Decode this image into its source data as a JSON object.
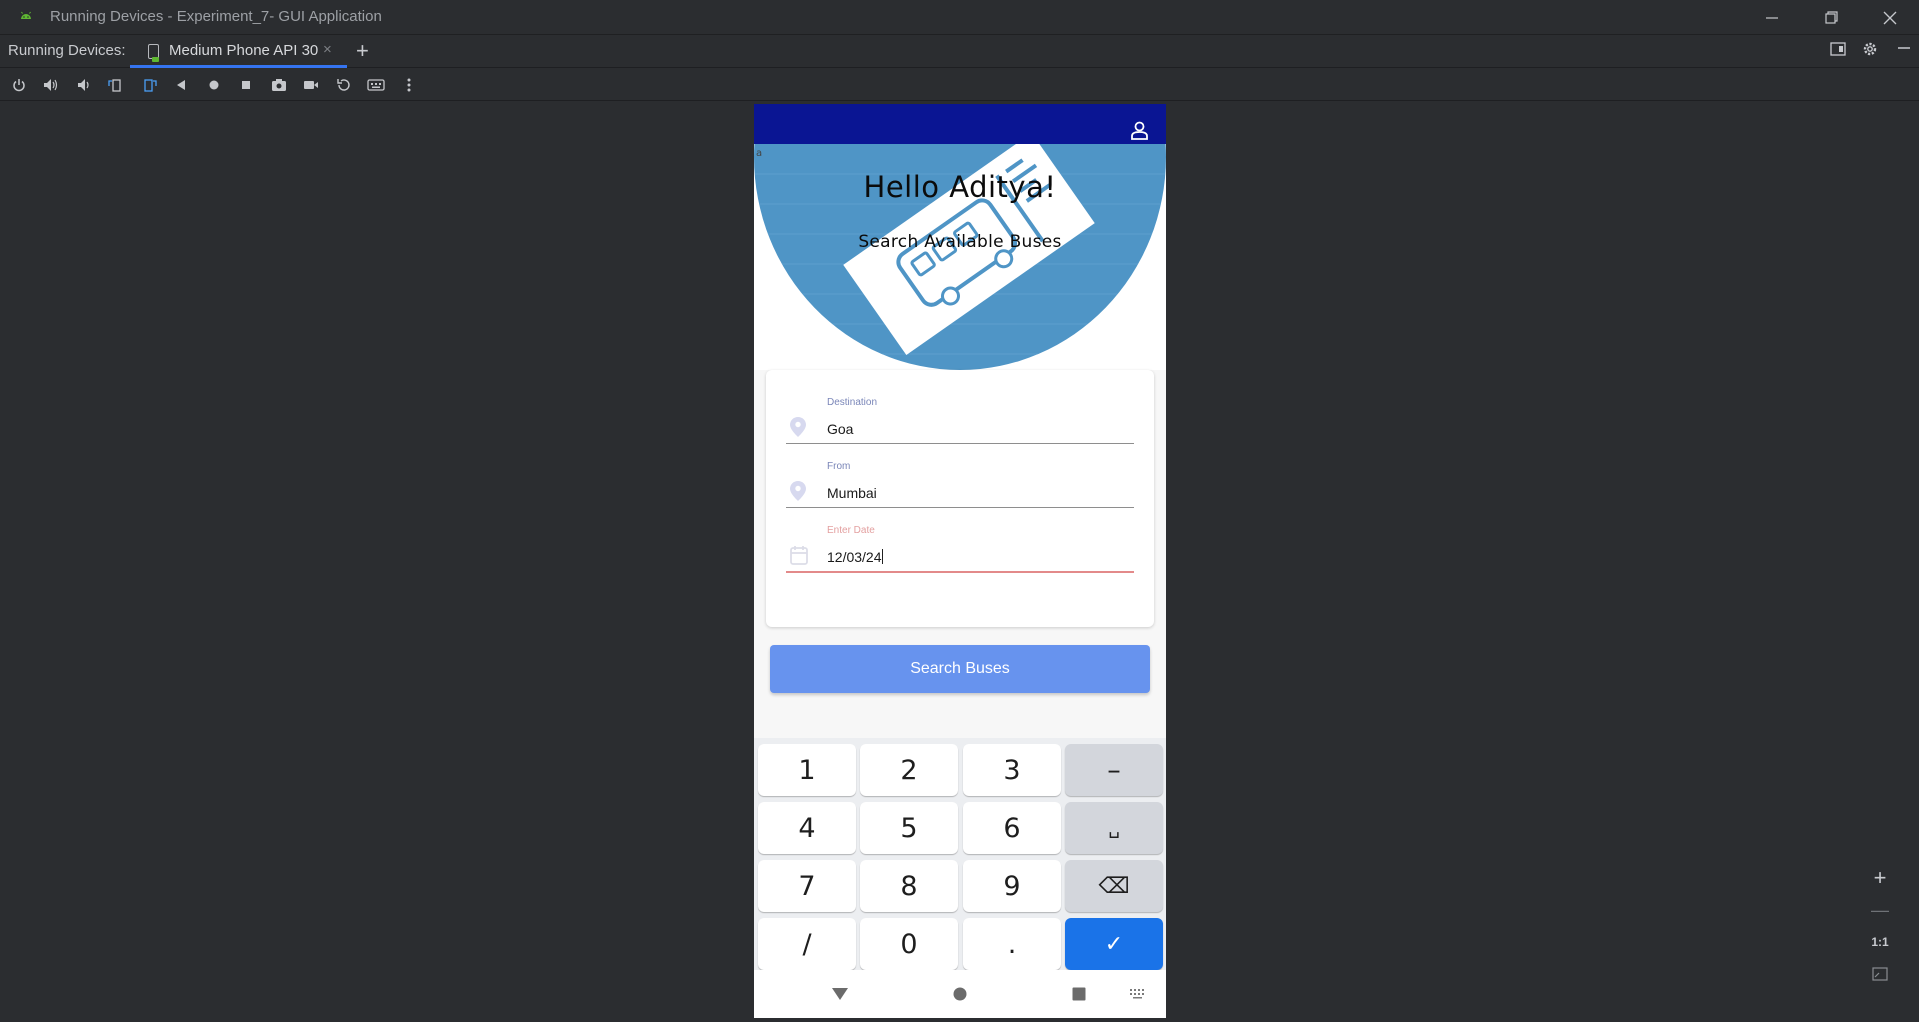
{
  "window": {
    "title": "Running Devices - Experiment_7- GUI Application"
  },
  "tabrow": {
    "label": "Running Devices:",
    "tab_label": "Medium Phone API 30",
    "close_glyph": "×",
    "add_glyph": "+"
  },
  "toolbar_icons": [
    "power-icon",
    "volume-up-icon",
    "volume-down-icon",
    "rotate-left-icon",
    "rotate-right-icon",
    "back-icon",
    "home-icon",
    "overview-icon",
    "screenshot-icon",
    "screen-record-icon",
    "reset-icon",
    "keyboard-icon",
    "more-icon"
  ],
  "zoom": {
    "plus": "+",
    "minus": "—",
    "one_to_one": "1:1"
  },
  "app": {
    "hero_tiny": "a",
    "greeting": "Hello Aditya!",
    "subtitle": "Search Available Buses",
    "fields": [
      {
        "label": "Destination",
        "value": "Goa",
        "icon": "location-pin-icon"
      },
      {
        "label": "From",
        "value": "Mumbai",
        "icon": "location-pin-icon"
      },
      {
        "label": "Enter Date",
        "value": "12/03/24",
        "icon": "calendar-icon"
      }
    ],
    "search_button": "Search Buses"
  },
  "keyboard": {
    "rows": [
      [
        "1",
        "2",
        "3",
        "–"
      ],
      [
        "4",
        "5",
        "6",
        "␣"
      ],
      [
        "7",
        "8",
        "9",
        "⌫"
      ],
      [
        "/",
        "0",
        ".",
        "✓"
      ]
    ]
  },
  "colors": {
    "app_bar": "#0a1593",
    "button": "#6793ee",
    "done_key": "#1a73e8",
    "accent_tab": "#3574f0"
  }
}
